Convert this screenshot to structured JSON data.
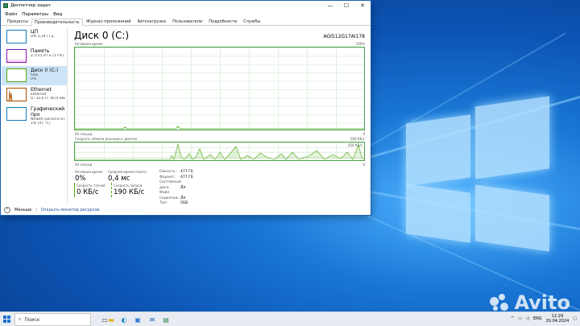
{
  "window": {
    "title": "Диспетчер задач",
    "controls": [
      "—",
      "☐",
      "✕"
    ]
  },
  "menu": [
    "Файл",
    "Параметры",
    "Вид"
  ],
  "tabs": [
    "Процессы",
    "Производительность",
    "Журнал приложений",
    "Автозагрузка",
    "Пользователи",
    "Подробности",
    "Службы"
  ],
  "active_tab": "Производительность",
  "sidebar": {
    "items": [
      {
        "name": "ЦП",
        "line1": "0% 2,34 ГГц",
        "line2": "",
        "color": "#117dbb"
      },
      {
        "name": "Память",
        "line1": "2,7/15,9 ГБ (17%)",
        "line2": "",
        "color": "#8b12ae"
      },
      {
        "name": "Диск 0 (C:)",
        "line1": "SSD",
        "line2": "0%",
        "color": "#4da60c"
      },
      {
        "name": "Ethernet",
        "line1": "Ethernet",
        "line2": "О: 32,0 П: 40,0 кбит/с",
        "color": "#a74f01"
      },
      {
        "name": "Графический про",
        "line1": "NVIDIA GeForce GTX 16",
        "line2": "1% (47 °C)",
        "color": "#117dbb"
      }
    ]
  },
  "main": {
    "title": "Диск 0 (C:)",
    "model": "AGI512G17AI178",
    "graph1": {
      "label": "Активное время",
      "max": "100%",
      "bottom_left": "60 секунд",
      "bottom_right": "0"
    },
    "graph2": {
      "label": "Скорость обмена данными с диском",
      "max": "500 КБ/с",
      "inner_max": "450 КБ/с",
      "bottom_left": "60 секунд",
      "bottom_right": "0"
    },
    "stats": {
      "active_time": {
        "label": "Активное время",
        "value": "0%"
      },
      "response": {
        "label": "Средняя время ответа",
        "value": "0,4 мс"
      },
      "read": {
        "label": "Скорость чтения",
        "value": "0 КБ/с"
      },
      "write": {
        "label": "Скорость записи",
        "value": "190 КБ/с"
      }
    },
    "props": [
      {
        "k": "Емкость:",
        "v": "477 ГБ"
      },
      {
        "k": "Формат:",
        "v": "477 ГБ"
      },
      {
        "k": "Системный диск:",
        "v": "Да"
      },
      {
        "k": "Файл подкачки:",
        "v": "Да"
      },
      {
        "k": "Тип:",
        "v": "SSD"
      }
    ]
  },
  "bottom": {
    "less": "Меньше",
    "monitor": "Открыть монитор ресурсов"
  },
  "taskbar": {
    "search_placeholder": "Поиск",
    "lang": "ENG",
    "time": "12:29",
    "date": "20.04.2024"
  },
  "watermark": "Avito"
}
